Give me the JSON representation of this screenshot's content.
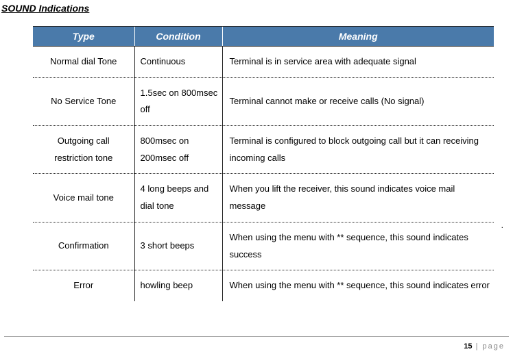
{
  "title": "SOUND Indications",
  "headers": {
    "type": "Type",
    "condition": "Condition",
    "meaning": "Meaning"
  },
  "rows": [
    {
      "type": "Normal dial Tone",
      "condition": "Continuous",
      "meaning": "Terminal is in service area with adequate signal"
    },
    {
      "type": "No Service Tone",
      "condition": "1.5sec on 800msec off",
      "meaning": "Terminal cannot make or receive calls (No signal)"
    },
    {
      "type": "Outgoing call restriction tone",
      "condition": "800msec on 200msec off",
      "meaning": "Terminal is configured to block outgoing call but it can receiving incoming calls"
    },
    {
      "type": "Voice mail tone",
      "condition": "4 long beeps and dial tone",
      "meaning": "When you lift the receiver, this sound indicates voice mail message"
    },
    {
      "type": "Confirmation",
      "condition": "3 short beeps",
      "meaning": "When using the menu with ** sequence, this sound indicates success"
    },
    {
      "type": "Error",
      "condition": "howling beep",
      "meaning": "When using the menu with ** sequence, this sound indicates error"
    }
  ],
  "footer": {
    "page_num": "15",
    "sep": " | ",
    "label": "page"
  }
}
